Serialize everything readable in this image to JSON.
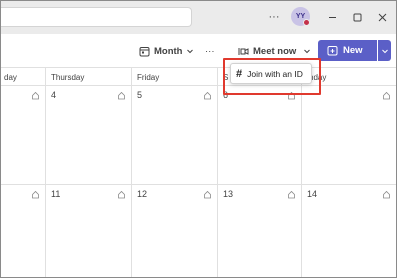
{
  "titlebar": {
    "more_label": "···",
    "avatar_initials": "YY",
    "minimize_label": "—",
    "maximize_label": "☐",
    "close_label": "✕"
  },
  "toolbar": {
    "view_label": "Month",
    "more_label": "···",
    "meet_now_label": "Meet now",
    "new_label": "New"
  },
  "calendar": {
    "day_headers": [
      "day",
      "Thursday",
      "Friday",
      "S",
      "nday"
    ],
    "week1": [
      "",
      "4",
      "5",
      "6",
      ""
    ],
    "week2": [
      "",
      "11",
      "12",
      "13",
      "14"
    ]
  },
  "popup": {
    "label": "Join with an ID"
  },
  "colors": {
    "accent": "#5b5fc7",
    "highlight": "#e0392e"
  }
}
